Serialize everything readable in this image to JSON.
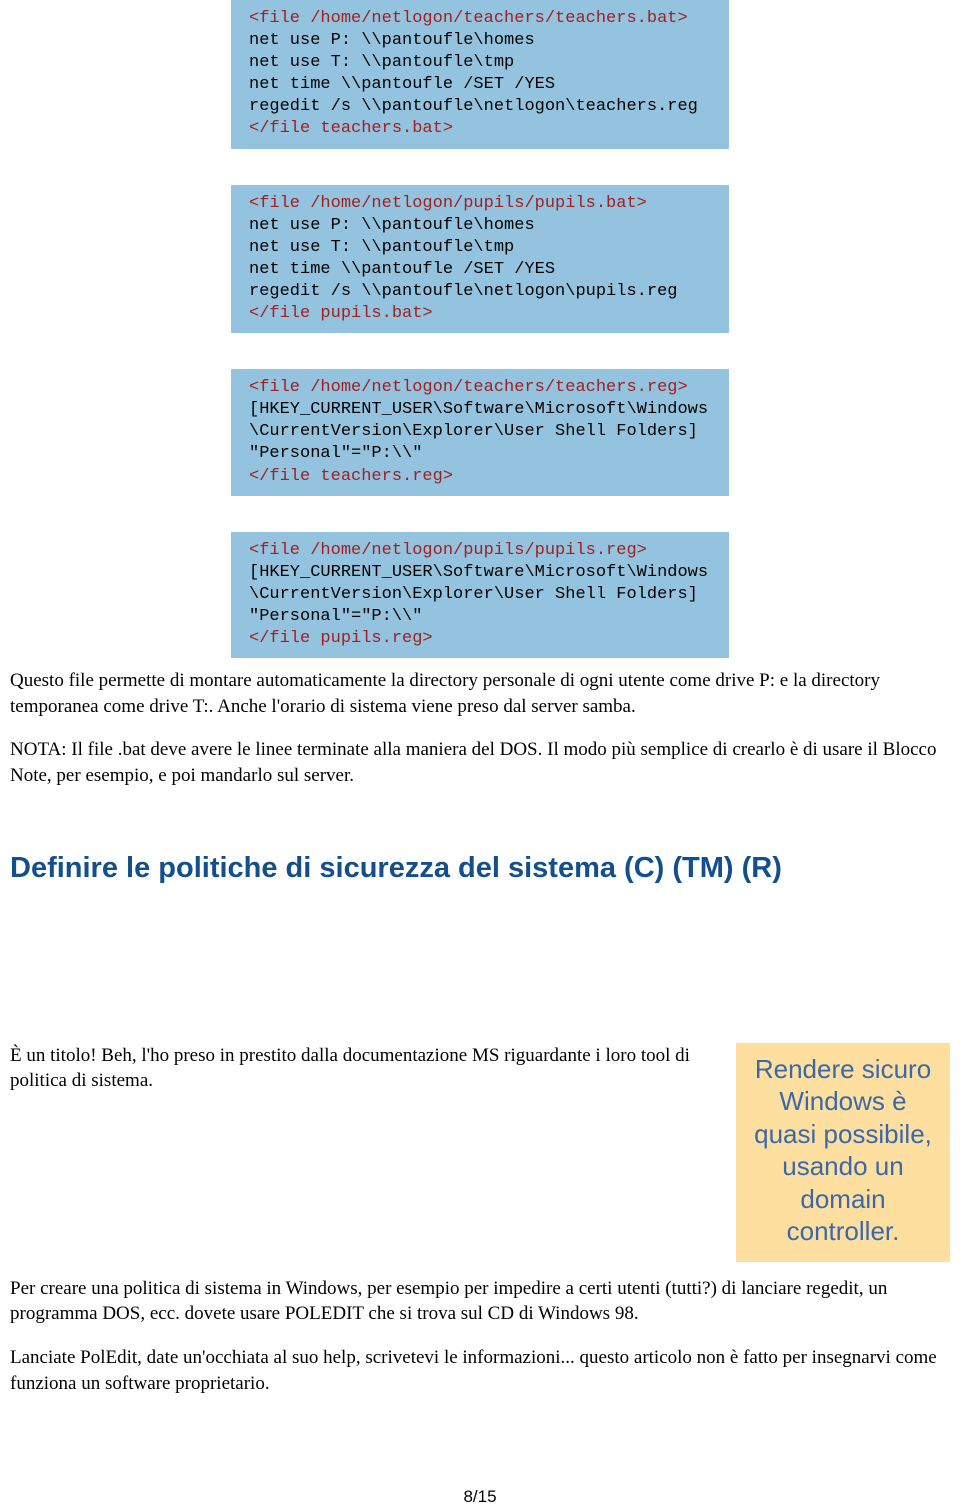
{
  "code": {
    "block1": [
      {
        "c": "red",
        "t": "<file /home/netlogon/teachers/teachers.bat>"
      },
      {
        "c": "",
        "t": "net use P: \\\\pantoufle\\homes"
      },
      {
        "c": "",
        "t": "net use T: \\\\pantoufle\\tmp"
      },
      {
        "c": "",
        "t": "net time \\\\pantoufle /SET /YES"
      },
      {
        "c": "",
        "t": "regedit /s \\\\pantoufle\\netlogon\\teachers.reg"
      },
      {
        "c": "red",
        "t": "</file teachers.bat>"
      }
    ],
    "block2": [
      {
        "c": "red",
        "t": "<file /home/netlogon/pupils/pupils.bat>"
      },
      {
        "c": "",
        "t": "net use P: \\\\pantoufle\\homes"
      },
      {
        "c": "",
        "t": "net use T: \\\\pantoufle\\tmp"
      },
      {
        "c": "",
        "t": "net time \\\\pantoufle /SET /YES"
      },
      {
        "c": "",
        "t": "regedit /s \\\\pantoufle\\netlogon\\pupils.reg"
      },
      {
        "c": "red",
        "t": "</file pupils.bat>"
      }
    ],
    "block3": [
      {
        "c": "red",
        "t": "<file /home/netlogon/teachers/teachers.reg>"
      },
      {
        "c": "",
        "t": "[HKEY_CURRENT_USER\\Software\\Microsoft\\Windows"
      },
      {
        "c": "",
        "t": "\\CurrentVersion\\Explorer\\User Shell Folders]"
      },
      {
        "c": "",
        "t": "\"Personal\"=\"P:\\\\\""
      },
      {
        "c": "red",
        "t": "</file teachers.reg>"
      }
    ],
    "block4": [
      {
        "c": "red",
        "t": "<file /home/netlogon/pupils/pupils.reg>"
      },
      {
        "c": "",
        "t": "[HKEY_CURRENT_USER\\Software\\Microsoft\\Windows"
      },
      {
        "c": "",
        "t": "\\CurrentVersion\\Explorer\\User Shell Folders]"
      },
      {
        "c": "",
        "t": "\"Personal\"=\"P:\\\\\""
      },
      {
        "c": "red",
        "t": "</file pupils.reg>"
      }
    ]
  },
  "paragraphs": {
    "p1": "Questo file permette di montare automaticamente la directory personale di ogni utente come drive P: e la directory temporanea come drive T:. Anche l'orario di sistema viene preso dal server samba.",
    "p2": "NOTA: Il file .bat deve avere le linee terminate alla maniera del DOS. Il modo più semplice di crearlo è di usare il Blocco Note, per esempio, e poi mandarlo sul server.",
    "p3": "È un titolo! Beh, l'ho preso in prestito dalla documentazione MS riguardante i loro tool di politica di sistema.",
    "p4": "Per creare una politica di sistema in Windows, per esempio per impedire a certi utenti (tutti?) di lanciare regedit, un programma DOS, ecc. dovete usare POLEDIT che si trova sul CD di Windows 98.",
    "p5": "Lanciate PolEdit, date un'occhiata al suo help, scrivetevi le informazioni... questo articolo non è fatto per insegnarvi come funziona un software proprietario."
  },
  "heading": "Definire le politiche di sicurezza del sistema (C) (TM) (R)",
  "callout": "Rendere sicuro Windows è quasi possibile, usando un domain controller.",
  "pagenum": "8/15"
}
